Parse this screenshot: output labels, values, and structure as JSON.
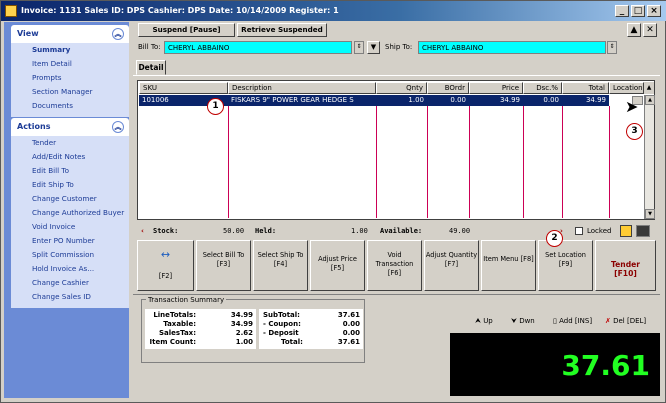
{
  "window": {
    "title": "Invoice: 1131  Sales ID: DPS  Cashier: DPS  Date: 10/14/2009  Register: 1"
  },
  "left_panel": {
    "view": {
      "header": "View",
      "items": [
        {
          "label": "Summary",
          "active": true
        },
        {
          "label": "Item Detail",
          "active": false
        },
        {
          "label": "Prompts",
          "active": false
        },
        {
          "label": "Section Manager",
          "active": false
        },
        {
          "label": "Documents",
          "active": false
        }
      ]
    },
    "actions": {
      "header": "Actions",
      "items": [
        {
          "label": "Tender"
        },
        {
          "label": "Add/Edit Notes"
        },
        {
          "label": "Edit Bill To"
        },
        {
          "label": "Edit Ship To"
        },
        {
          "label": "Change Customer"
        },
        {
          "label": "Change Authorized Buyer"
        },
        {
          "label": "Void Invoice"
        },
        {
          "label": "Enter PO Number"
        },
        {
          "label": "Split Commission"
        },
        {
          "label": "Hold Invoice As..."
        },
        {
          "label": "Change Cashier"
        },
        {
          "label": "Change Sales ID"
        }
      ]
    }
  },
  "toolbar": {
    "suspend": "Suspend [Pause]",
    "retrieve": "Retrieve Suspended"
  },
  "bill_to": {
    "label": "Bill To:",
    "value": "CHERYL ABBAINO"
  },
  "ship_to": {
    "label": "Ship To:",
    "value": "CHERYL ABBAINO"
  },
  "tab": {
    "detail": "Detail"
  },
  "grid": {
    "columns": [
      "SKU",
      "Description",
      "Qnty",
      "BOrdr",
      "Price",
      "Dsc.%",
      "Total",
      "Location"
    ],
    "rows": [
      {
        "sku": "101006",
        "description": "FISKARS 9\" POWER GEAR HEDGE S",
        "qnty": "1.00",
        "bordr": "0.00",
        "price": "34.99",
        "dsc": "0.00",
        "total": "34.99",
        "location": ""
      }
    ]
  },
  "stock_bar": {
    "stock_label": "Stock:",
    "stock": "50.00",
    "held_label": "Held:",
    "held": "1.00",
    "available_label": "Available:",
    "available": "49.00",
    "locked_label": "Locked"
  },
  "function_buttons": [
    {
      "label": "",
      "key": "[F2]"
    },
    {
      "label": "Select Bill To",
      "key": "[F3]"
    },
    {
      "label": "Select Ship To",
      "key": "[F4]"
    },
    {
      "label": "Adjust Price",
      "key": "[F5]"
    },
    {
      "label": "Void Transaction",
      "key": "[F6]"
    },
    {
      "label": "Adjust Quantity",
      "key": "[F7]"
    },
    {
      "label": "Item Menu",
      "key": "[F8]"
    },
    {
      "label": "Set Location",
      "key": "[F9]"
    },
    {
      "label": "Tender",
      "key": "[F10]"
    }
  ],
  "summary": {
    "title": "Transaction Summary",
    "line_totals_label": "LineTotals:",
    "line_totals": "34.99",
    "taxable_label": "Taxable:",
    "taxable": "34.99",
    "sales_tax_label": "SalesTax:",
    "sales_tax": "2.62",
    "item_count_label": "Item Count:",
    "item_count": "1.00",
    "subtotal_label": "SubTotal:",
    "subtotal": "37.61",
    "coupon_label": "- Coupon:",
    "coupon": "0.00",
    "deposit_label": "- Deposit",
    "deposit": "0.00",
    "total_label": "Total:",
    "total": "37.61"
  },
  "line_actions": {
    "up": "Up",
    "down": "Dwn",
    "add": "Add [INS]",
    "del": "Del [DEL]"
  },
  "total_display": "37.61",
  "markers": [
    "1",
    "2",
    "3"
  ],
  "colors": {
    "title_bar": "#0a246a",
    "nav_panel": "#6b8bd6",
    "field_bg": "#00ffff",
    "selected_row": "#0a246a",
    "total_text": "#22ff22",
    "tender_text": "#8b0000"
  }
}
